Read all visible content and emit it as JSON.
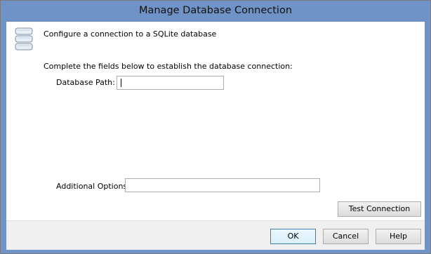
{
  "window": {
    "title": "Manage Database Connection"
  },
  "header": {
    "description": "Configure a connection to a SQLite database",
    "icon": "database-icon"
  },
  "form": {
    "instructions": "Complete the fields below to establish the database connection:",
    "database_path_label": "Database Path:",
    "database_path_value": "",
    "additional_options_label": "Additional Options:",
    "additional_options_value": "",
    "test_connection_label": "Test Connection"
  },
  "footer": {
    "ok_label": "OK",
    "cancel_label": "Cancel",
    "help_label": "Help"
  },
  "colors": {
    "titlebar": "#6f93c6",
    "default_button_border": "#3c7fb1"
  }
}
